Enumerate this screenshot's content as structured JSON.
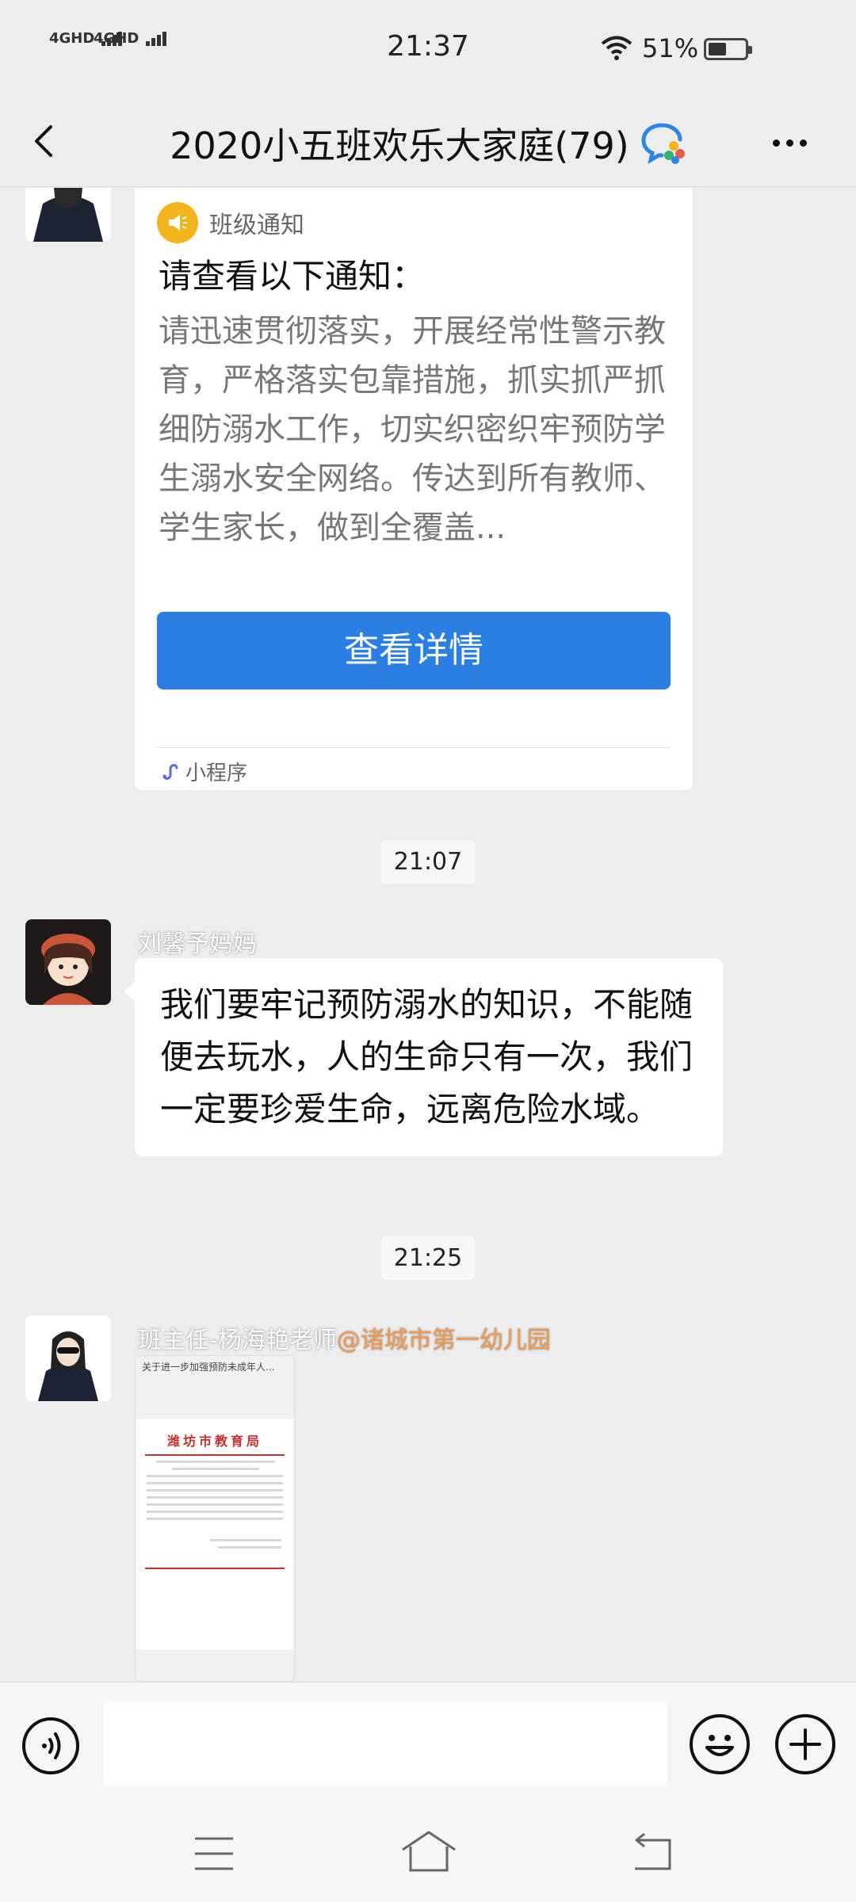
{
  "status_bar": {
    "network1": "4GHD",
    "network2": "4GHD",
    "time": "21:37",
    "battery": "51%",
    "battery_level": 0.51
  },
  "header": {
    "title": "2020小五班欢乐大家庭(79)",
    "back_icon": "chevron-left-icon",
    "more_icon": "more-dots-icon"
  },
  "notice_card": {
    "tag": "班级通知",
    "title": "请查看以下通知：",
    "body": "请迅速贯彻落实，开展经常性警示教育，严格落实包靠措施，抓实抓严抓细防溺水工作，切实织密织牢预防学生溺水安全网络。传达到所有教师、学生家长，做到全覆盖...",
    "button": "查看详情",
    "footer": "小程序"
  },
  "timestamps": [
    "21:07",
    "21:25"
  ],
  "messages": [
    {
      "sender": "刘馨予妈妈",
      "text": "我们要牢记预防溺水的知识，不能随便去玩水，人的生命只有一次，我们一定要珍爱生命，远离危险水域。"
    },
    {
      "sender": "班主任-杨海艳老师",
      "sender_tag": "@诸城市第一幼儿园"
    }
  ],
  "thumbnail": {
    "top_bar": "关于进一步加强预防未成年人...",
    "org": "潍坊市教育局"
  },
  "colors": {
    "background": "#ededed",
    "accent_blue": "#2b7fe3",
    "tag_orange": "#f09a4c",
    "megaphone_yellow": "#f3b51e"
  }
}
